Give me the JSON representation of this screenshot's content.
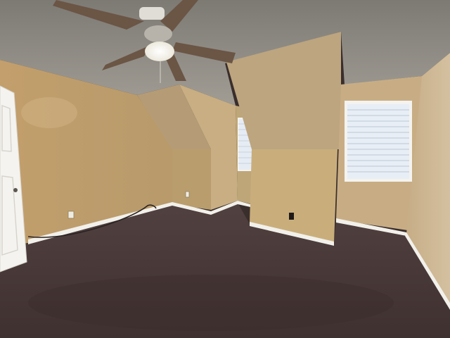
{
  "scene": {
    "type": "photo",
    "subject": "empty-attic-bedroom",
    "colors": {
      "ceiling": "#8f8c86",
      "wall_warm": "#c7a877",
      "wall_shadow": "#b3976a",
      "dormer_face": "#bfa57d",
      "carpet": "#4a3a37",
      "baseboard": "#f2f0ea",
      "door": "#f4f3ef",
      "fan_blade": "#6b5545",
      "fan_light": "#f7f5ec",
      "window_glass": "#e8eef6"
    }
  }
}
